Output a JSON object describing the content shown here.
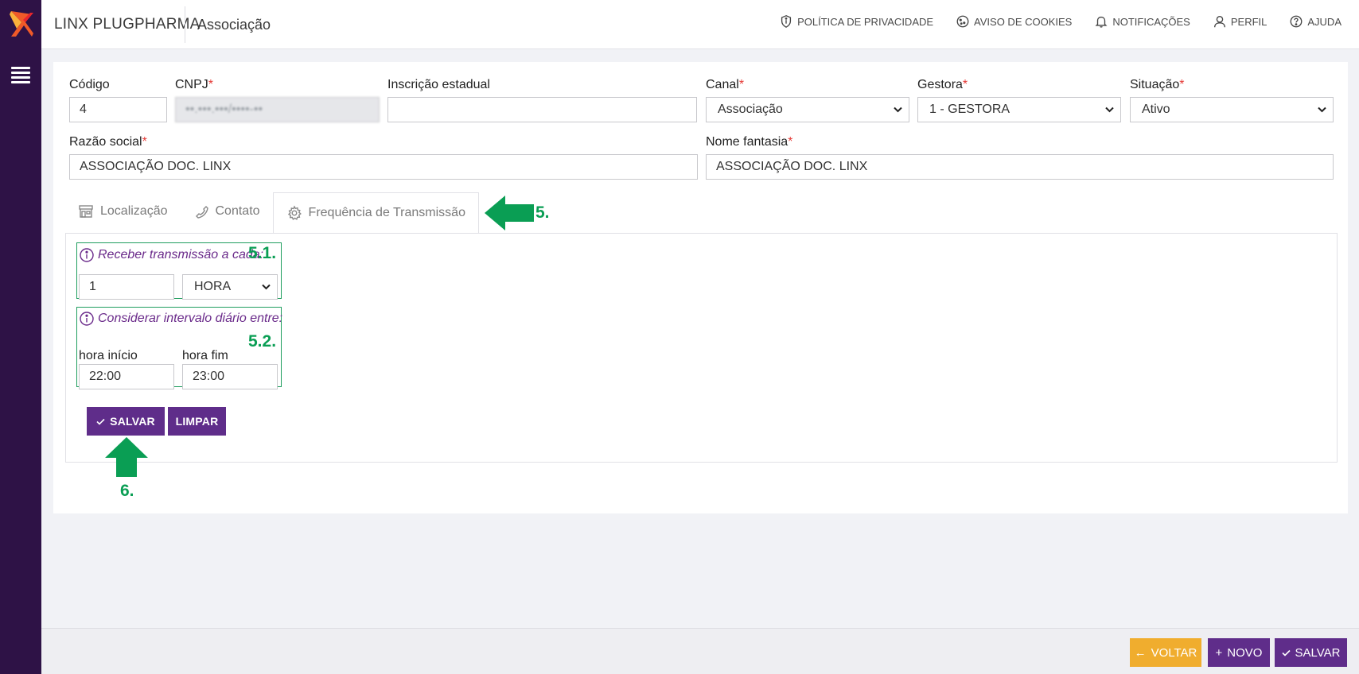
{
  "header": {
    "brand": "LINX PLUGPHARMA",
    "title": "Associação",
    "links": [
      {
        "label": "POLÍTICA DE PRIVACIDADE",
        "icon": "shield-icon"
      },
      {
        "label": "AVISO DE COOKIES",
        "icon": "cookie-icon"
      },
      {
        "label": "NOTIFICAÇÕES",
        "icon": "bell-icon"
      },
      {
        "label": "PERFIL",
        "icon": "user-icon"
      },
      {
        "label": "AJUDA",
        "icon": "help-icon"
      }
    ]
  },
  "form": {
    "codigo": {
      "label": "Código",
      "value": "4"
    },
    "cnpj": {
      "label": "CNPJ",
      "required": "*",
      "value": "••.•••.•••/••••-••"
    },
    "inscricao": {
      "label": "Inscrição estadual",
      "value": ""
    },
    "canal": {
      "label": "Canal",
      "required": "*",
      "value": "Associação"
    },
    "gestora": {
      "label": "Gestora",
      "required": "*",
      "value": "1 - GESTORA"
    },
    "situacao": {
      "label": "Situação",
      "required": "*",
      "value": "Ativo"
    },
    "razao": {
      "label": "Razão social",
      "required": "*",
      "value": "ASSOCIAÇÃO DOC. LINX"
    },
    "fantasia": {
      "label": "Nome fantasia",
      "required": "*",
      "value": "ASSOCIAÇÃO DOC. LINX"
    }
  },
  "tabs": [
    {
      "label": "Localização",
      "icon": "store-icon"
    },
    {
      "label": "Contato",
      "icon": "phone-icon"
    },
    {
      "label": "Frequência de Transmissão",
      "icon": "gear-icon",
      "active": true
    }
  ],
  "frequency": {
    "receive_label": "Receber transmissão a cada:",
    "interval_value": "1",
    "interval_unit": "HORA",
    "daily_label": "Considerar intervalo diário entre:",
    "start_label": "hora início",
    "start_value": "22:00",
    "end_label": "hora fim",
    "end_value": "23:00",
    "save_label": "SALVAR",
    "clear_label": "LIMPAR"
  },
  "annotations": {
    "tab": "5.",
    "receive": "5.1.",
    "daily": "5.2.",
    "save": "6."
  },
  "footer": {
    "back_label": "VOLTAR",
    "new_label": "NOVO",
    "save_label": "SALVAR"
  },
  "colors": {
    "sidebar": "#2e1246",
    "primary": "#5f2d8a",
    "warning": "#f0ad2e",
    "annotation": "#0a9e54"
  }
}
